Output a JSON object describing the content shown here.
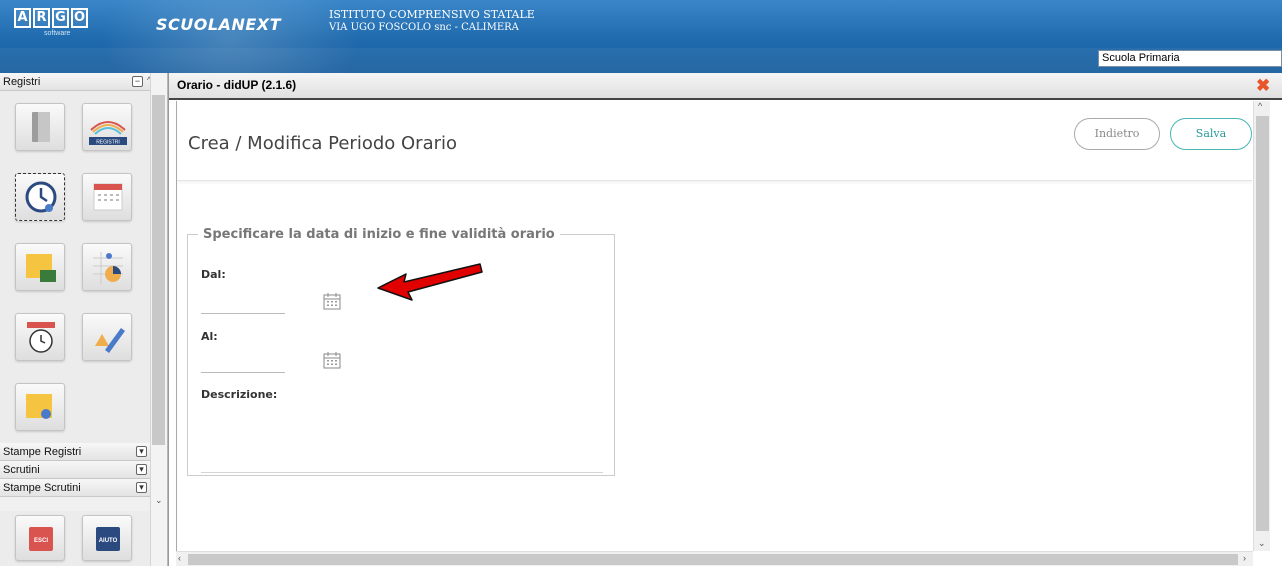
{
  "header": {
    "logo_letters": [
      "A",
      "R",
      "G",
      "O"
    ],
    "logo_sub": "software",
    "product": "SCUOLANEXT",
    "school_name": "ISTITUTO COMPRENSIVO STATALE",
    "school_address": "VIA UGO FOSCOLO snc - CALIMERA",
    "school_select_value": "Scuola Primaria"
  },
  "sidebar": {
    "sections": [
      "Registri",
      "Stampe Registri",
      "Scrutini",
      "Stampe Scrutini"
    ],
    "tile_badge_registri": "REGISTRI",
    "bottom_buttons": [
      "ESCI",
      "AIUTO"
    ]
  },
  "panel": {
    "title": "Orario - didUP (2.1.6)",
    "close_icon": "close-icon"
  },
  "form": {
    "title": "Crea / Modifica Periodo Orario",
    "back_label": "Indietro",
    "save_label": "Salva",
    "fieldset_legend": "Specificare la data di inizio e fine validità orario",
    "from_label": "Dal:",
    "to_label": "Al:",
    "description_label": "Descrizione:",
    "from_value": "",
    "to_value": ""
  },
  "colors": {
    "header_blue": "#1f6aad",
    "save_teal": "#2b9a9a",
    "close_orange": "#e8552b",
    "annotation_red": "#e00000"
  }
}
